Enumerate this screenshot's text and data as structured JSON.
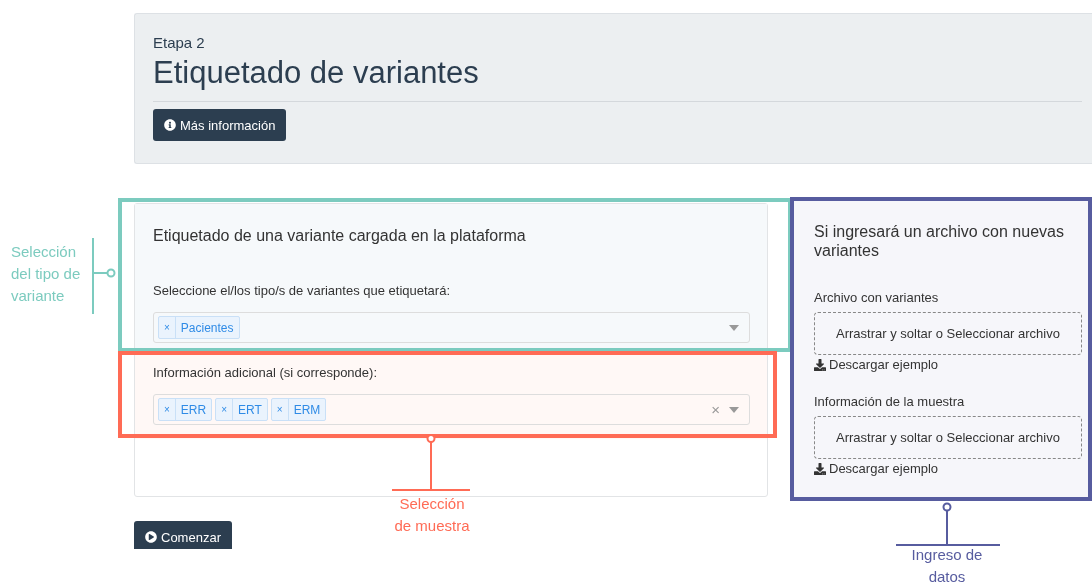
{
  "header": {
    "step": "Etapa 2",
    "title": "Etiquetado de variantes",
    "info_button": "Más información"
  },
  "label_card": {
    "title": "Etiquetado de una variante cargada en la plataforma",
    "fields": [
      {
        "label": "Seleccione el/los tipo/s de variantes que etiquetará:",
        "tags": [
          {
            "remove": "×",
            "text": "Pacientes"
          }
        ]
      },
      {
        "label": "Información adicional (si corresponde):",
        "tags": [
          {
            "remove": "×",
            "text": "ERR"
          },
          {
            "remove": "×",
            "text": "ERT"
          },
          {
            "remove": "×",
            "text": "ERM"
          }
        ],
        "clear": "×"
      }
    ]
  },
  "upload_card": {
    "title": "Si ingresará un archivo con nuevas variantes",
    "uploads": [
      {
        "label": "Archivo con variantes",
        "dropzone": "Arrastrar y soltar o Seleccionar archivo",
        "download": "Descargar ejemplo"
      },
      {
        "label": "Información de la muestra",
        "dropzone": "Arrastrar y soltar o Seleccionar archivo",
        "download": "Descargar ejemplo"
      }
    ]
  },
  "start_button": "Comenzar",
  "annotations": [
    {
      "text": "Selección del tipo de variante",
      "color": "#7ccbbf"
    },
    {
      "text": "Selección de muestra",
      "color": "#ff6b55"
    },
    {
      "text": "Ingreso de datos",
      "color": "#575c9f"
    }
  ]
}
